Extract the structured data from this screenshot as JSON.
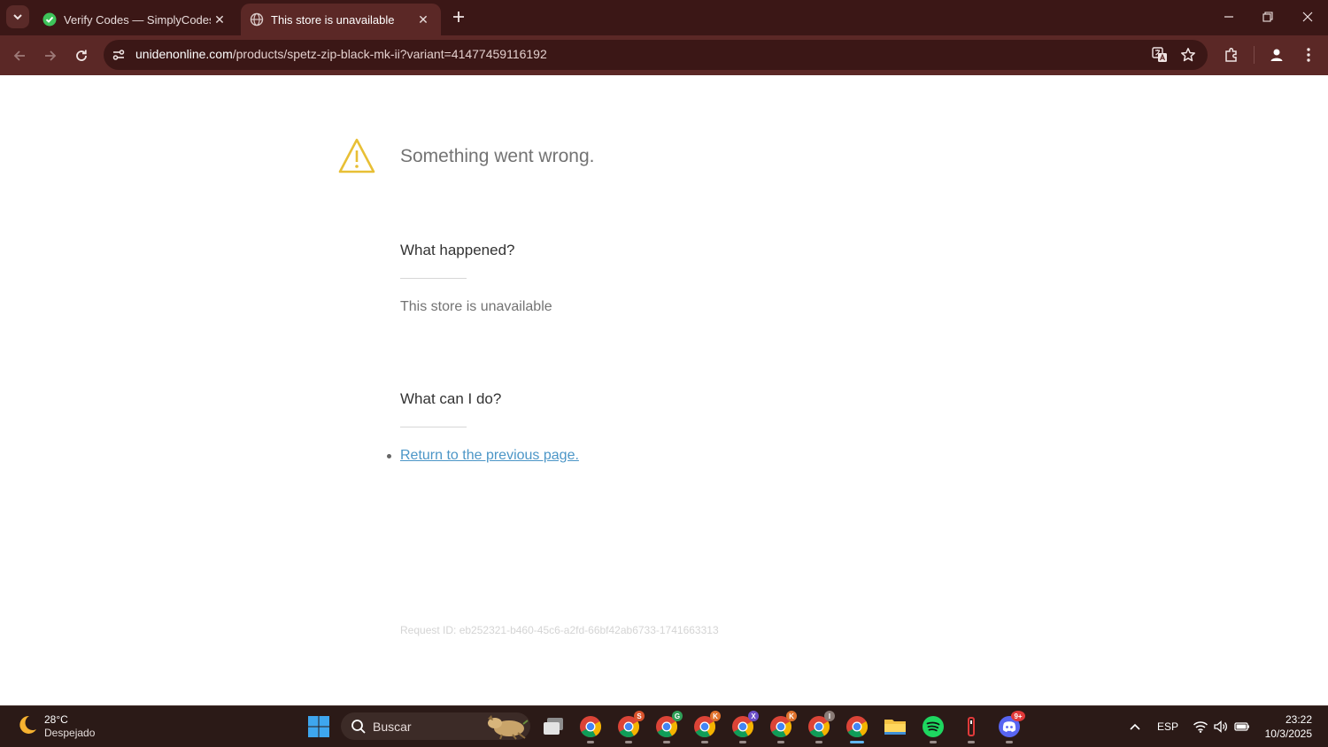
{
  "browser": {
    "tabs": [
      {
        "title": "Verify Codes — SimplyCodes",
        "active": false
      },
      {
        "title": "This store is unavailable",
        "active": true
      }
    ],
    "url_domain": "unidenonline.com",
    "url_path": "/products/spetz-zip-black-mk-ii?variant=41477459116192",
    "colors": {
      "frame": "#3b1716",
      "toolbar": "#5b2826",
      "accent": "#4c96c7"
    }
  },
  "page": {
    "heading": "Something went wrong.",
    "what_happened_title": "What happened?",
    "what_happened_text": "This store is unavailable",
    "what_can_i_do_title": "What can I do?",
    "return_link": "Return to the previous page.",
    "request_id": "Request ID: eb252321-b460-45c6-a2fd-66bf42ab6733-1741663313"
  },
  "taskbar": {
    "weather_temp": "28°C",
    "weather_desc": "Despejado",
    "search_placeholder": "Buscar",
    "language": "ESP",
    "time": "23:22",
    "date": "10/3/2025",
    "apps": [
      {
        "name": "task-view-icon"
      },
      {
        "name": "chrome-icon",
        "badge": ""
      },
      {
        "name": "chrome-icon",
        "badge": "S"
      },
      {
        "name": "chrome-icon",
        "badge": "G"
      },
      {
        "name": "chrome-icon",
        "badge": "K"
      },
      {
        "name": "chrome-icon",
        "badge": "X"
      },
      {
        "name": "chrome-icon",
        "badge": "K"
      },
      {
        "name": "chrome-icon",
        "badge": "I"
      },
      {
        "name": "chrome-icon",
        "badge": ""
      },
      {
        "name": "file-explorer-icon"
      },
      {
        "name": "spotify-icon"
      },
      {
        "name": "app-icon"
      },
      {
        "name": "discord-icon",
        "badge": "9+"
      }
    ]
  }
}
